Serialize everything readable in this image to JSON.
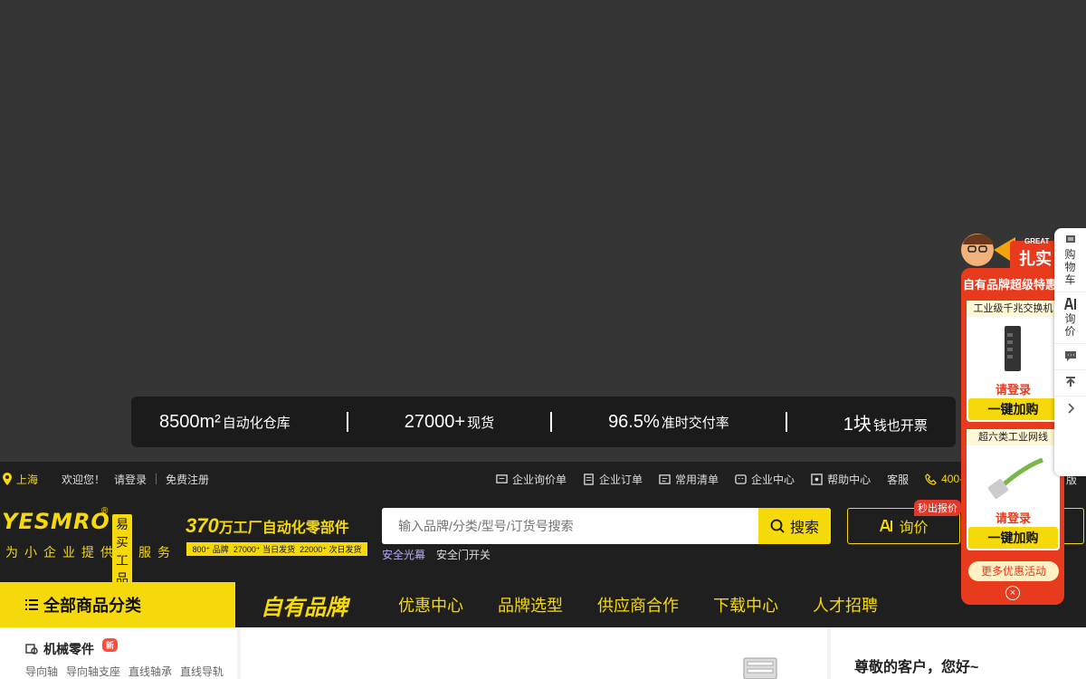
{
  "stats": [
    {
      "num": "8500m²",
      "label": "自动化仓库"
    },
    {
      "num": "27000+",
      "label": "现货"
    },
    {
      "num": "96.5%",
      "label": "准时交付率"
    },
    {
      "num": "1块",
      "label": "钱也开票"
    }
  ],
  "topbar": {
    "location": "上海",
    "welcome": "欢迎您！",
    "login": "请登录",
    "register": "免费注册",
    "links": [
      "企业询价单",
      "企业订单",
      "常用清单",
      "企业中心",
      "帮助中心"
    ],
    "service": "客服",
    "phone": "400-",
    "version": "版"
  },
  "header": {
    "logo_brand": "YESMRO",
    "logo_reg": "®",
    "logo_cn": "易买工品",
    "slogan": "为小企业提供好服务",
    "tag_num": "370",
    "tag_text": "万工厂自动化零部件",
    "tag_stats": [
      "800⁺ 品牌",
      "27000⁺ 当日发货",
      "22000⁺ 次日发货"
    ],
    "search_placeholder": "输入品牌/分类/型号/订货号搜索",
    "search_button": "搜索",
    "hot_keywords": [
      "安全光幕",
      "安全门开关"
    ],
    "inquiry_label": "询价",
    "quote_badge": "秒出报价"
  },
  "nav": {
    "all_categories": "全部商品分类",
    "own_brand": "自有品牌",
    "links": [
      "优惠中心",
      "品牌选型",
      "供应商合作",
      "下载中心",
      "人才招聘"
    ]
  },
  "content": {
    "category_title": "机械零件",
    "category_badge": "新",
    "category_subs": [
      "导向轴",
      "导向轴支座",
      "直线轴承",
      "直线导轨"
    ],
    "greeting": "尊敬的客户，您好~"
  },
  "promo": {
    "great": "GREAT",
    "big": "扎实",
    "title": "自有品牌超级特惠",
    "items": [
      {
        "caption": "工业级千兆交换机",
        "login": "请登录",
        "buy": "一键加购"
      },
      {
        "caption": "超六类工业网线",
        "login": "请登录",
        "buy": "一键加购"
      }
    ],
    "more": "更多优惠活动",
    "close": "×"
  },
  "sidebar": {
    "cart": "购物车",
    "inquiry": "询价"
  },
  "colors": {
    "brand_yellow": "#f5d90a",
    "dark_bg": "#1f1f1f",
    "promo_red": "#e83a1c"
  }
}
